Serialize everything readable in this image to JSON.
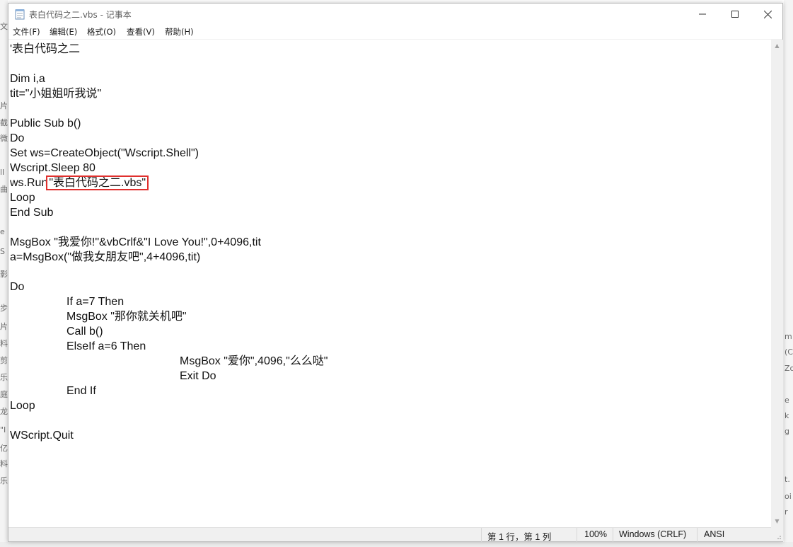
{
  "window": {
    "title": "表白代码之二.vbs - 记事本"
  },
  "menu": [
    "文件(F)",
    "编辑(E)",
    "格式(O)",
    "查看(V)",
    "帮助(H)"
  ],
  "code": {
    "lines": [
      "'表白代码之二",
      "",
      "Dim i,a",
      "tit=\"小姐姐听我说\"",
      "",
      "Public Sub b()",
      "Do",
      "Set ws=CreateObject(\"Wscript.Shell\")",
      "Wscript.Sleep 80",
      "",
      "Loop",
      "End Sub",
      "",
      "MsgBox \"我爱你!\"&vbCrlf&\"I Love You!\",0+4096,tit",
      "a=MsgBox(\"做我女朋友吧\",4+4096,tit)",
      "",
      "Do",
      "If a=7 Then",
      "MsgBox \"那你就关机吧\"",
      "Call b()",
      "ElseIf a=6 Then",
      "MsgBox \"爱你\",4096,\"么么哒\"",
      "Exit Do",
      "End If",
      "Loop",
      "",
      "WScript.Quit"
    ],
    "run_prefix": "ws.Run",
    "run_arg": "\"表白代码之二.vbs\""
  },
  "status": {
    "position": "第 1 行，第 1 列",
    "zoom": "100%",
    "line_ending": "Windows (CRLF)",
    "encoding": "ANSI"
  },
  "background_fragments": [
    "文",
    "片",
    "截",
    "微",
    "lI",
    "曲",
    "e",
    "S",
    "影",
    "步",
    "片",
    "料",
    "剪",
    "乐",
    "庭",
    "龙",
    "\"I",
    "亿",
    "料",
    "乐",
    "m",
    "(C",
    "Zo",
    "e",
    "k",
    "g",
    "t.",
    "oi",
    "r"
  ],
  "colors": {
    "highlight": "#e0302e"
  }
}
